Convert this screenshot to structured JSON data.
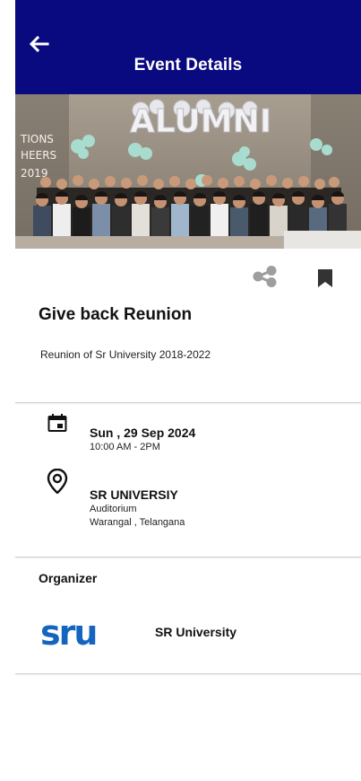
{
  "header": {
    "back_icon": "arrow-left-icon",
    "title": "Event Details",
    "bg_color": "#0a0a80"
  },
  "hero": {
    "banner_text": "ALUMNI"
  },
  "actions": {
    "share_icon": "share-icon",
    "bookmark_icon": "bookmark-icon"
  },
  "event": {
    "title": "Give back Reunion",
    "subtitle": "Reunion of Sr University 2018-2022"
  },
  "schedule": {
    "icon": "calendar-icon",
    "date": "Sun , 29 Sep 2024",
    "time": "10:00 AM - 2PM"
  },
  "location": {
    "icon": "map-pin-icon",
    "name": "SR UNIVERSIY",
    "line1": "Auditorium",
    "line2": "Warangal , Telangana"
  },
  "organizer": {
    "label": "Organizer",
    "logo_text": "sru",
    "logo_color": "#1565c0",
    "name": "SR University"
  }
}
